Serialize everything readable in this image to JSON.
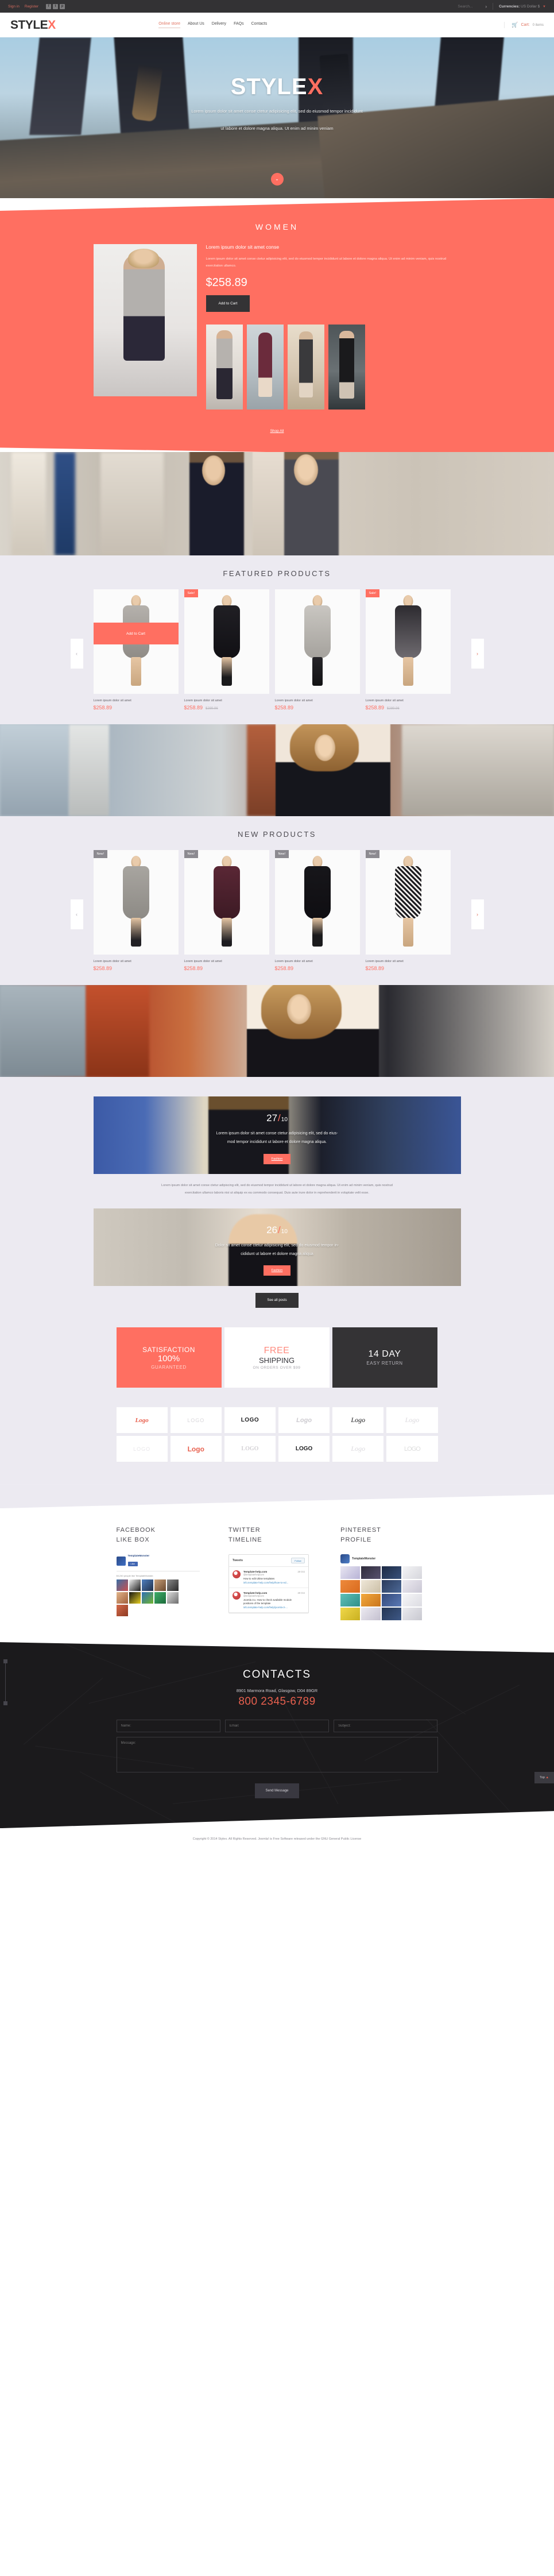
{
  "topbar": {
    "signin": "Sign in",
    "register": "Register",
    "social": [
      {
        "name": "facebook-icon",
        "glyph": "f"
      },
      {
        "name": "twitter-icon",
        "glyph": "t"
      },
      {
        "name": "pinterest-icon",
        "glyph": "p"
      }
    ],
    "search_placeholder": "Search...",
    "search_go": "›",
    "currencies_label": "Currencies:",
    "currency_value": "US Dollar $",
    "caret": "▼"
  },
  "header": {
    "logo_main": "STYLE",
    "logo_accent": "X",
    "nav": [
      {
        "label": "Online store",
        "active": true
      },
      {
        "label": "About Us",
        "active": false
      },
      {
        "label": "Delivery",
        "active": false
      },
      {
        "label": "FAQs",
        "active": false
      },
      {
        "label": "Contacts",
        "active": false
      }
    ],
    "cart_icon": "🛒",
    "cart_label": "Cart:",
    "cart_count": "0 items"
  },
  "hero": {
    "title_main": "STYLE",
    "title_accent": "X",
    "subtitle_line1": "Lorem ipsum dolor sit amet conse ctetur adipisicing elit, sed do eiusmod tempor incididunt",
    "subtitle_line2": "ut labore et dolore magna aliqua. Ut enim ad minim veniam",
    "scroll_icon": "⌄"
  },
  "women": {
    "title": "WOMEN",
    "product_title": "Lorem ipsum dolor sit amet conse",
    "description": "Lorem ipsum dolor sit amet conse ctetur adipisicing elit, sed do eiusmod tempor incididunt ut labore et dolore magna aliqua. Ut enim ad minim veniam, quis nostrud exercitation ullamco.",
    "price": "$258.89",
    "add_to_cart": "Add to Cart",
    "shop_all": "Shop All"
  },
  "featured": {
    "title": "FEATURED PRODUCTS",
    "prev": "‹",
    "next": "›",
    "hover_label": "Add to Cart",
    "products": [
      {
        "name": "Lorem ipsum dolor sit amet",
        "price": "$258.89",
        "old_price": "",
        "badge": ""
      },
      {
        "name": "Lorem ipsum dolor sit amet",
        "price": "$258.89",
        "old_price": "$289.96",
        "badge": "Sale!"
      },
      {
        "name": "Lorem ipsum dolor sit amet",
        "price": "$258.89",
        "old_price": "",
        "badge": ""
      },
      {
        "name": "Lorem ipsum dolor sit amet",
        "price": "$258.89",
        "old_price": "$289.96",
        "badge": "Sale!"
      }
    ]
  },
  "newproducts": {
    "title": "NEW PRODUCTS",
    "prev": "‹",
    "next": "›",
    "products": [
      {
        "name": "Lorem ipsum dolor sit amet",
        "price": "$258.89",
        "badge": "New!"
      },
      {
        "name": "Lorem ipsum dolor sit amet",
        "price": "$258.89",
        "badge": "New!"
      },
      {
        "name": "Lorem ipsum dolor sit amet",
        "price": "$258.89",
        "badge": "New!"
      },
      {
        "name": "Lorem ipsum dolor sit amet",
        "price": "$258.89",
        "badge": "New!"
      }
    ]
  },
  "posts": {
    "post1": {
      "day": "27",
      "slash": "/",
      "month": "10",
      "text_line1": "Lorem ipsum dolor sit amet conse ctetur adipisicing elit, sed do eius-",
      "text_line2": "mod tempor incididunt ut labore et dolore magna aliqua.",
      "button": "Fashion",
      "excerpt_line1": "Lorem ipsum dolor sit amet conse ctetur adipiscing elit, sed do eiusmod tempor incididunt ut labore et dolore magna aliqua. Ut enim ad minim veniam, quis nostrud",
      "excerpt_line2": "exercitation ullamco laboris nisi ut aliquip ex ea commodo consequat. Duis aute irure dolor in reprehenderit in voluptate velit esse."
    },
    "post2": {
      "day": "26",
      "slash": "/",
      "month": "10",
      "text_line1": "Dolor sit amet conse ctetur adipisicing elit, sed do eiusmod tempor in-",
      "text_line2": "cididunt ut labore et dolore magna aliqua",
      "button": "Fashion"
    },
    "see_all": "See all posts"
  },
  "benefits": [
    {
      "l1": "SATISFACTION",
      "l2": "100%",
      "l3": "GUARANTEED",
      "style": "coral"
    },
    {
      "l1": "FREE",
      "l2": "SHIPPING",
      "l3": "ON ORDERS OVER $99",
      "style": "white"
    },
    {
      "l1": "14 DAY",
      "l2": "",
      "l3": "EASY RETURN",
      "style": "dark"
    }
  ],
  "brands": {
    "row1": [
      "Logo",
      "LOGO",
      "LOGO",
      "Logo",
      "Logo",
      "Logo"
    ],
    "row2": [
      "LOGO",
      "Logo",
      "LOGO",
      "LOGO",
      "Logo",
      "LOGO"
    ]
  },
  "social": {
    "facebook": {
      "heading_line1": "FACEBOOK",
      "heading_line2": "LIKE BOX",
      "page_name": "TemplateMonster",
      "like_button": "Like",
      "likes_text": "60,240 people like TemplateMonster."
    },
    "twitter": {
      "heading_line1": "TWITTER",
      "heading_line2": "TIMELINE",
      "box_title": "Tweets",
      "follow": "Follow",
      "tweets": [
        {
          "name": "Template-help.com",
          "handle": "@templatehelpcom",
          "date": "20 Oct",
          "text": "How to edit Ultise templates",
          "link": "info.template-help.com/help/how-to-ed..."
        },
        {
          "name": "Template-help.com",
          "handle": "@templatehelpcom",
          "date": "20 Oct",
          "text": "Joomla 3.x. How to check available module positions of the template",
          "link": "info.template-help.com/help/joomla-3-..."
        }
      ]
    },
    "pinterest": {
      "heading_line1": "PINTEREST",
      "heading_line2": "PROFILE",
      "profile_name": "TemplateMonster"
    }
  },
  "contacts": {
    "title": "CONTACTS",
    "address": "8901 Marmora Road, Glasgow, D04 89GR",
    "phone": "800 2345-6789",
    "name_placeholder": "Name:",
    "email_placeholder": "Email:",
    "subject_placeholder": "Subject:",
    "message_placeholder": "Message:",
    "send_button": "Send Message",
    "top_label": "Top",
    "top_icon": "▲"
  },
  "footer": {
    "copyright": "Copyright © 2014 Stylex. All Rights Reserved. Joomla! is Free Software released under the GNU General Public License"
  },
  "colors": {
    "accent": "#ff6f61",
    "dark": "#343335",
    "light_bg": "#eceaf1"
  }
}
